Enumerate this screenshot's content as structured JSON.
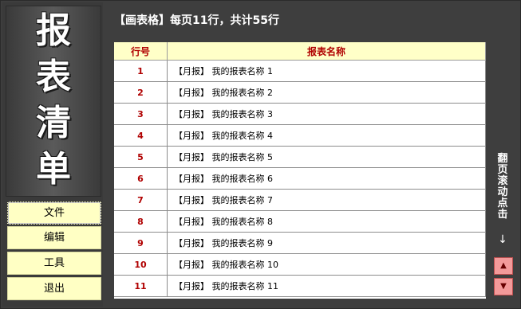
{
  "title_chars": [
    "报",
    "表",
    "清",
    "单"
  ],
  "menu": [
    {
      "label": "文件"
    },
    {
      "label": "编辑"
    },
    {
      "label": "工具"
    },
    {
      "label": "退出"
    }
  ],
  "header": {
    "text": "【画表格】每页11行，共计55行"
  },
  "table": {
    "columns": [
      "行号",
      "报表名称"
    ],
    "rows": [
      {
        "num": "1",
        "name": "【月报】 我的报表名称 1"
      },
      {
        "num": "2",
        "name": "【月报】 我的报表名称 2"
      },
      {
        "num": "3",
        "name": "【月报】 我的报表名称 3"
      },
      {
        "num": "4",
        "name": "【月报】 我的报表名称 4"
      },
      {
        "num": "5",
        "name": "【月报】 我的报表名称 5"
      },
      {
        "num": "6",
        "name": "【月报】 我的报表名称 6"
      },
      {
        "num": "7",
        "name": "【月报】 我的报表名称 7"
      },
      {
        "num": "8",
        "name": "【月报】 我的报表名称 8"
      },
      {
        "num": "9",
        "name": "【月报】 我的报表名称 9"
      },
      {
        "num": "10",
        "name": "【月报】 我的报表名称 10"
      },
      {
        "num": "11",
        "name": "【月报】 我的报表名称 11"
      }
    ]
  },
  "side": {
    "label_chars": [
      "翻",
      "页",
      "滚",
      "动",
      "点",
      "击"
    ],
    "arrow": "↓",
    "up_icon": "▲",
    "down_icon": "▼"
  },
  "colors": {
    "accent_red": "#b00000",
    "header_bg": "#ffffc8",
    "menu_bg": "#ffffc4",
    "scroll_btn": "#f39a9a"
  }
}
